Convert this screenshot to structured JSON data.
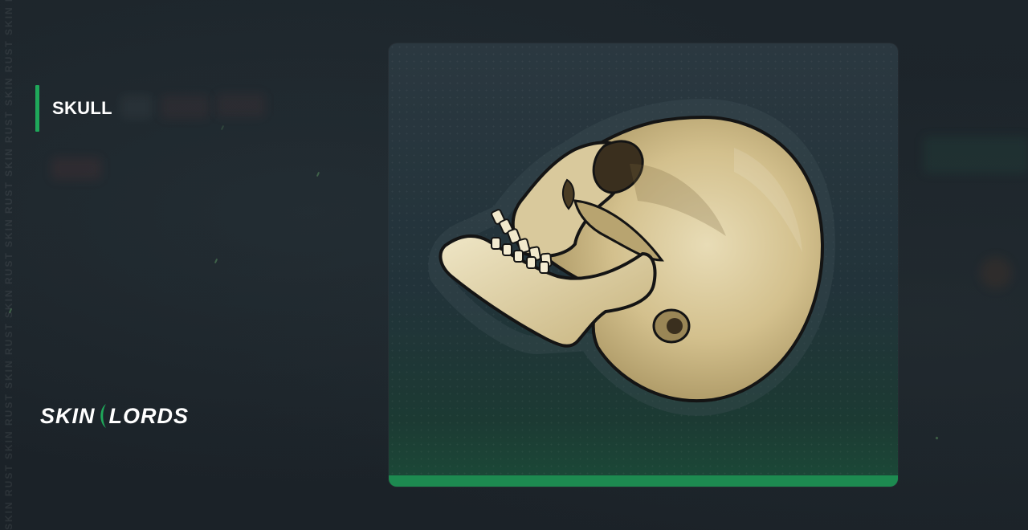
{
  "item": {
    "name": "SKULL"
  },
  "brand": {
    "logo_left": "SKIN",
    "logo_right": "LORDS",
    "watermark": "SKIN RUST SKIN RUST SKIN RUST SKIN RUST SKIN RUST SKIN RUST SKIN RUST SKIN RUST SKIN RUST"
  },
  "colors": {
    "accent": "#1fa85a",
    "background": "#1c2329",
    "card_bottom": "#1d8a50"
  },
  "icons": {
    "item_image": "skull-icon"
  }
}
